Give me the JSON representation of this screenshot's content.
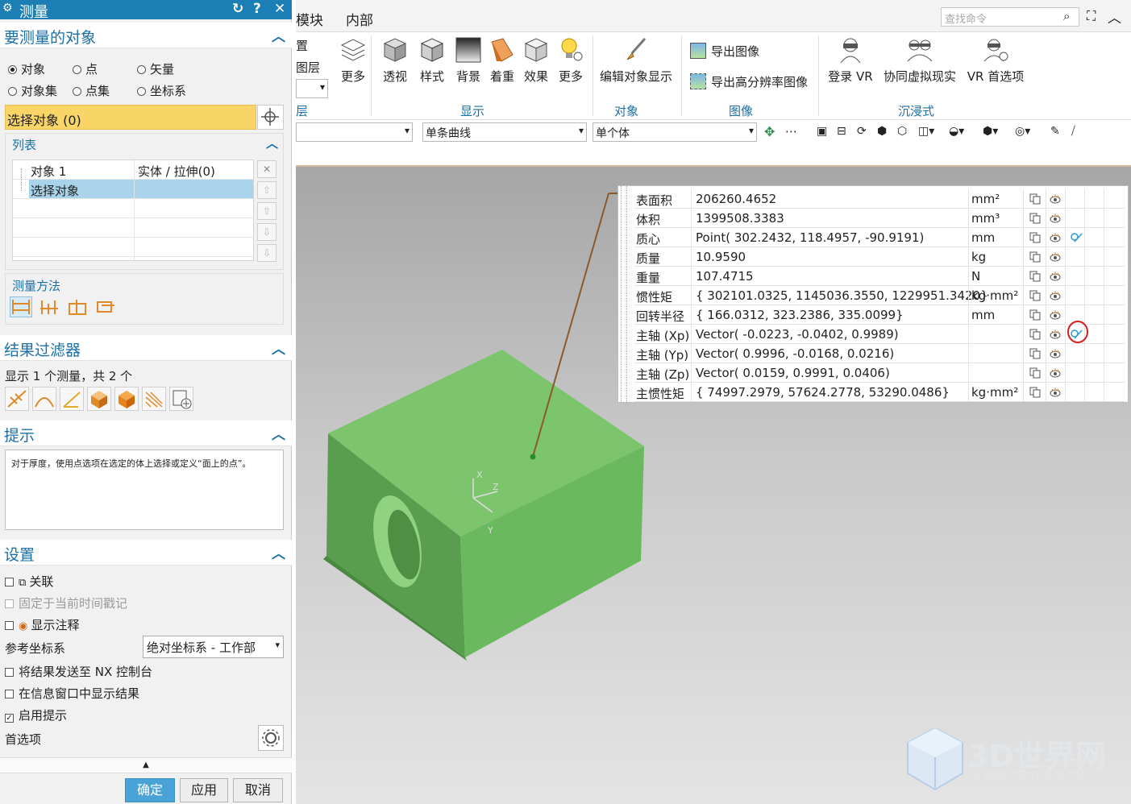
{
  "dialog": {
    "title": "测量",
    "title_buttons": [
      "↻",
      "?",
      "✕"
    ],
    "section_objects": "要测量的对象",
    "radio_options": [
      {
        "label": "对象",
        "selected": true
      },
      {
        "label": "点",
        "selected": false
      },
      {
        "label": "矢量",
        "selected": false
      },
      {
        "label": "对象集",
        "selected": false
      },
      {
        "label": "点集",
        "selected": false
      },
      {
        "label": "坐标系",
        "selected": false
      }
    ],
    "select_object_label": "选择对象 (0)",
    "list_header": "列表",
    "list_rows": [
      {
        "name": "对象 1",
        "type": "实体 / 拉伸(0)"
      },
      {
        "name": "选择对象",
        "type": ""
      }
    ],
    "method_header": "测量方法",
    "section_filter": "结果过滤器",
    "filter_text": "显示 1 个测量，共 2 个",
    "section_hint": "提示",
    "hint_text": "对于厚度，使用点选项在选定的体上选择或定义“面上的点”。",
    "section_settings": "设置",
    "settings": {
      "associative": "关联",
      "fixed_time": "固定于当前时间戳记",
      "show_annotation": "显示注释",
      "ref_csys_label": "参考坐标系",
      "ref_csys_value": "绝对坐标系 - 工作部",
      "send_console": "将结果发送至 NX 控制台",
      "show_info": "在信息窗口中显示结果",
      "enable_hint": "启用提示",
      "preferences": "首选项"
    },
    "buttons": {
      "ok": "确定",
      "apply": "应用",
      "cancel": "取消"
    }
  },
  "ribbon": {
    "tabs": [
      "模块",
      "内部"
    ],
    "search_placeholder": "查找命令",
    "partial_labels": [
      "置",
      "图层",
      "更多",
      "层"
    ],
    "display_buttons": [
      "透视",
      "样式",
      "背景",
      "着重",
      "效果",
      "更多"
    ],
    "object_button": "编辑对象显示",
    "image_buttons": [
      "导出图像",
      "导出高分辨率图像"
    ],
    "vr_buttons": [
      "登录 VR",
      "协同虚拟现实",
      "VR 首选项"
    ],
    "group_labels": [
      "显示",
      "对象",
      "图像",
      "沉浸式"
    ],
    "filter_curve": "单条曲线",
    "filter_body": "单个体"
  },
  "results": [
    {
      "label": "表面积",
      "value": "206260.4652",
      "unit": "mm²"
    },
    {
      "label": "体积",
      "value": "1399508.3383",
      "unit": "mm³"
    },
    {
      "label": "质心",
      "value": "Point( 302.2432, 118.4957, -90.9191)",
      "unit": "mm"
    },
    {
      "label": "质量",
      "value": "10.9590",
      "unit": "kg"
    },
    {
      "label": "重量",
      "value": "107.4715",
      "unit": "N"
    },
    {
      "label": "惯性矩",
      "value": "{ 302101.0325, 1145036.3550, 1229951.3420}",
      "unit": "kg·mm²"
    },
    {
      "label": "回转半径",
      "value": "{ 166.0312, 323.2386, 335.0099}",
      "unit": "mm"
    },
    {
      "label": "主轴 (Xp)",
      "value": "Vector( -0.0223, -0.0402, 0.9989)",
      "unit": ""
    },
    {
      "label": "主轴 (Yp)",
      "value": "Vector( 0.9996, -0.0168, 0.0216)",
      "unit": ""
    },
    {
      "label": "主轴 (Zp)",
      "value": "Vector( 0.0159, 0.9991, 0.0406)",
      "unit": ""
    },
    {
      "label": "主惯性矩",
      "value": "{ 74997.2979, 57624.2778, 53290.0486}",
      "unit": "kg·mm²"
    }
  ],
  "axis_labels": {
    "x": "X",
    "y": "Y",
    "z": "Z"
  },
  "watermark": {
    "name": "3D世界网",
    "url": "WWW.3DSJW.COM"
  },
  "colors": {
    "accent": "#1b7fb6",
    "highlight": "#f9d466",
    "model": "#6cc063"
  }
}
